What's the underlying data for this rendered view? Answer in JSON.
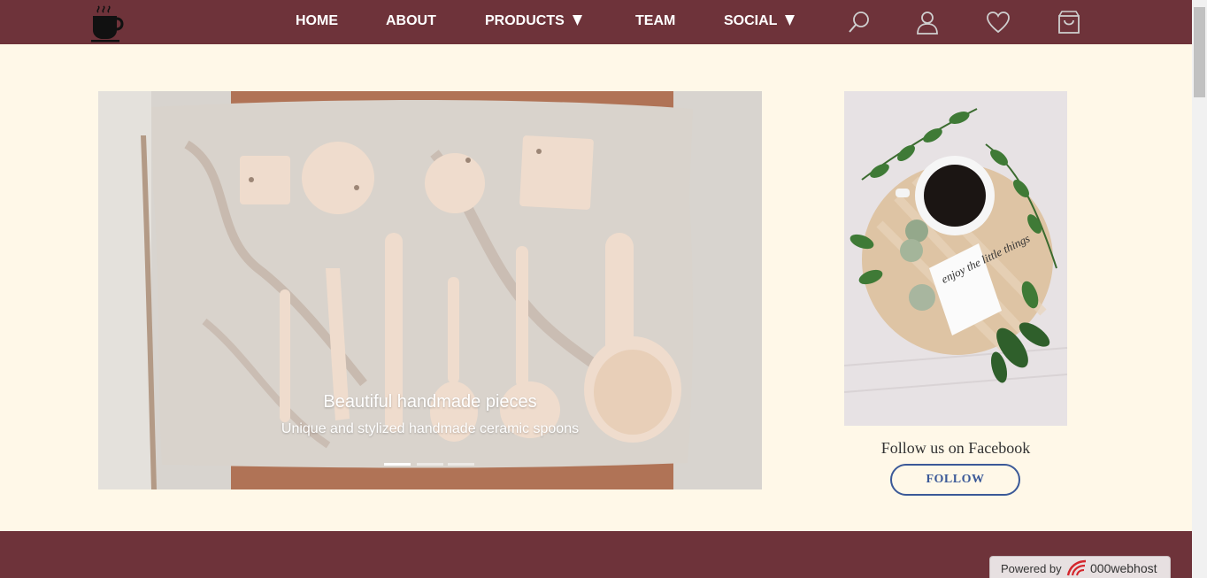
{
  "colors": {
    "navbar_bg": "#6e333a",
    "page_bg": "#fff8e8",
    "footer_bg": "#6e333a",
    "follow_accent": "#3b5998"
  },
  "logo": {
    "icon": "coffee-cup-icon"
  },
  "nav": {
    "home": "HOME",
    "about": "ABOUT",
    "products": "PRODUCTS",
    "team": "TEAM",
    "social": "SOCIAL",
    "icons": [
      "search-icon",
      "user-icon",
      "heart-icon",
      "shopping-bag-icon"
    ]
  },
  "carousel": {
    "title": "Beautiful handmade pieces",
    "subtitle": "Unique and stylized handmade ceramic spoons",
    "slide_count": 3,
    "active_slide": 1
  },
  "sidebar": {
    "photo_text": "enjoy the little things",
    "follow_text": "Follow us on Facebook",
    "follow_button": "FOLLOW"
  },
  "badge": {
    "powered": "Powered by",
    "brand": "000webhost"
  }
}
